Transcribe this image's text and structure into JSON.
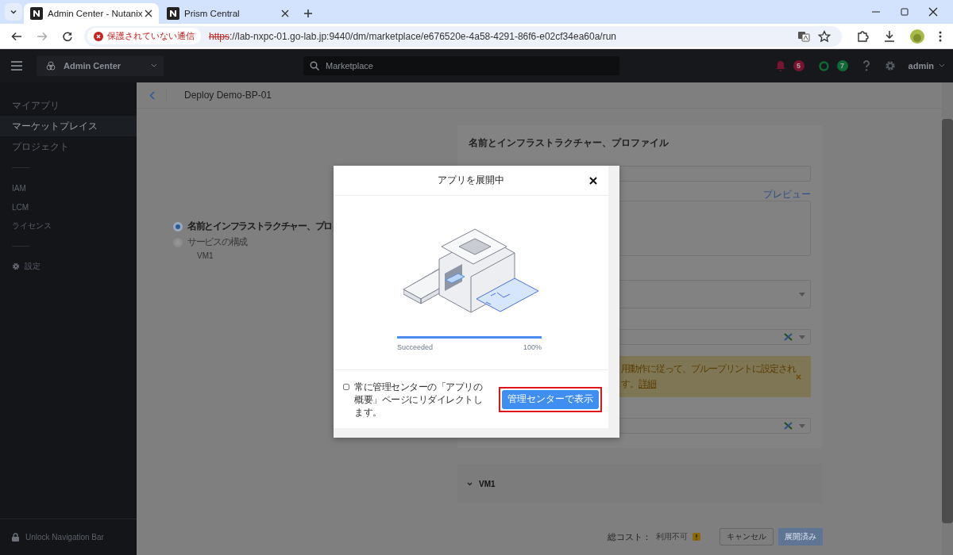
{
  "browser": {
    "tabs": [
      {
        "title": "Admin Center - Nutanix",
        "selected": true
      },
      {
        "title": "Prism Central",
        "selected": false
      }
    ],
    "security_label": "保護されていない通信",
    "url_scheme": "https",
    "url_rest": "://lab-nxpc-01.go-lab.jp:9440/dm/marketplace/e676520e-4a58-4291-86f6-e02cf34ea60a/run"
  },
  "header": {
    "app": "Admin Center",
    "search": "Marketplace",
    "alerts": "5",
    "tasks": "7",
    "user": "admin"
  },
  "sidebar": {
    "groups": [
      [
        {
          "label": "マイアプリ",
          "selected": false,
          "kind": "link"
        },
        {
          "label": "マーケットプレイス",
          "selected": true,
          "kind": "link"
        },
        {
          "label": "プロジェクト",
          "selected": false,
          "kind": "link"
        }
      ],
      [
        {
          "label": "IAM",
          "selected": false,
          "kind": "link"
        },
        {
          "label": "LCM",
          "selected": false,
          "kind": "link"
        },
        {
          "label": "ライセンス",
          "selected": false,
          "kind": "link"
        }
      ],
      [
        {
          "label": "設定",
          "selected": false,
          "kind": "settings"
        }
      ]
    ],
    "footer": "Unlock Navigation Bar"
  },
  "page": {
    "title": "Deploy Demo-BP-01",
    "steps": [
      {
        "label": "名前とインフラストラクチャー、プロ",
        "selected": true,
        "kind": "step"
      },
      {
        "label": "サービスの構成",
        "selected": false,
        "kind": "step"
      },
      {
        "label": "VM1",
        "selected": false,
        "kind": "substep"
      }
    ]
  },
  "form": {
    "heading": "名前とインフラストラクチャー、プロファイル",
    "preview_link": "プレビュー",
    "alert": {
      "line1": "用動作に従って、ブループリントに設定され",
      "line2": "す。",
      "link": "詳細"
    },
    "section": "VM1"
  },
  "footer": {
    "cost_label": "総コスト：",
    "cost_value": "利用不可",
    "cancel": "キャンセル",
    "deploy": "展開済み",
    "deploy_disabled": true
  },
  "modal": {
    "title": "アプリを展開中",
    "progress": {
      "level": 1,
      "status": "Succeeded",
      "percent": "100%"
    },
    "redirect": {
      "checked": false,
      "label": "常に管理センターの「アプリの概要」ページにリダイレクトします。"
    },
    "button": "管理センターで表示",
    "highlighted": true
  }
}
